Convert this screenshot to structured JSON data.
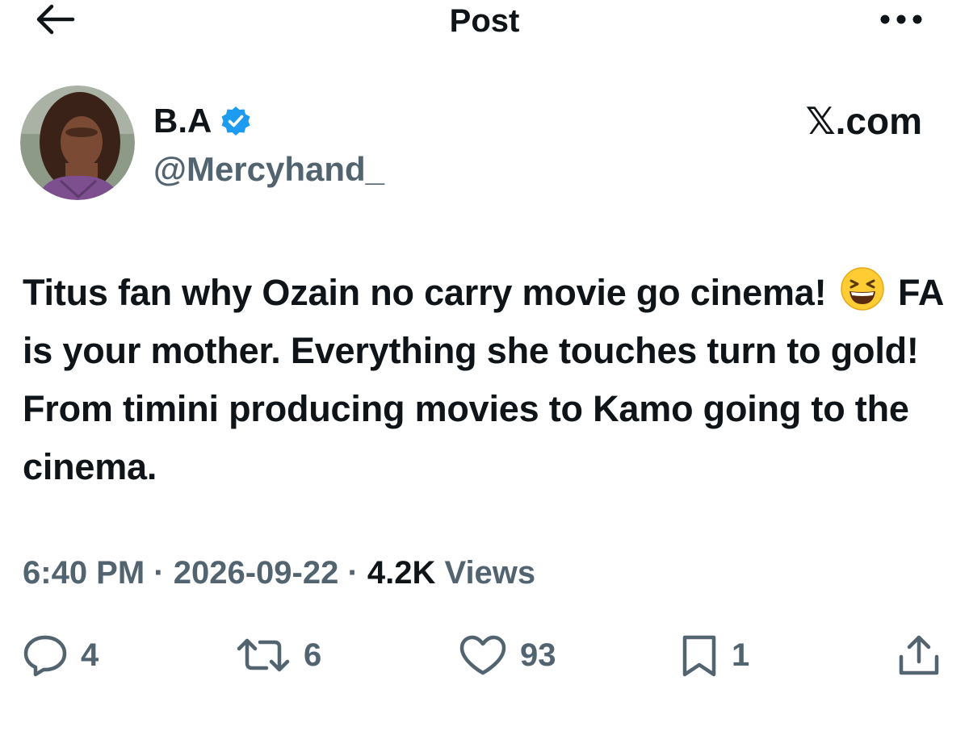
{
  "header": {
    "title": "Post",
    "back_icon": "arrow-left-icon",
    "more_icon": "more-dots-icon"
  },
  "author": {
    "display_name": "B.A",
    "handle": "@Mercyhand_",
    "verified": true,
    "verified_color": "#1d9bf0"
  },
  "watermark": "𝕏.com",
  "post": {
    "text_before_emoji": "Titus fan why Ozain no carry movie go cinema!",
    "emoji": "grinning-squinting-face",
    "text_after_emoji": "FA is your mother. Everything she touches turn to gold! From timini producing movies to Kamo going to the cinema."
  },
  "meta": {
    "time": "6:40 PM",
    "separator": " · ",
    "date": "2026-09-22",
    "views_count": "4.2K",
    "views_label": " Views"
  },
  "actions": {
    "reply_count": "4",
    "repost_count": "6",
    "like_count": "93",
    "bookmark_count": "1",
    "icons": [
      "reply-icon",
      "repost-icon",
      "like-icon",
      "bookmark-icon",
      "share-icon"
    ]
  },
  "colors": {
    "text_primary": "#0f1419",
    "text_secondary": "#536471",
    "accent": "#1d9bf0"
  }
}
